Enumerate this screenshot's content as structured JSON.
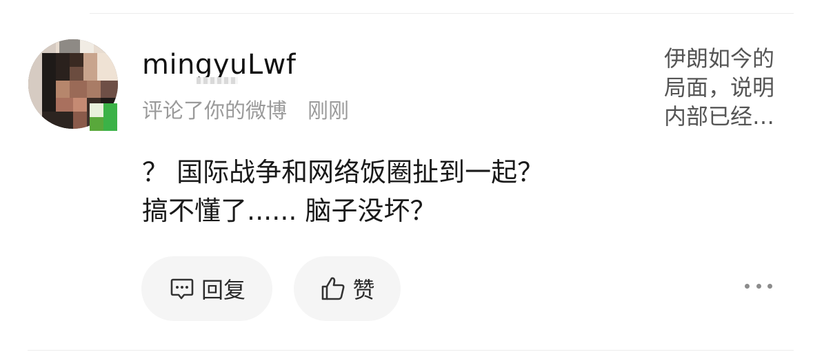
{
  "comment": {
    "username": "mingyuLwf",
    "action": "评论了你的微博",
    "time": "刚刚",
    "quoted_post": "伊朗如今的\n局面，说明\n内部已经…",
    "content_lines": [
      "？ 国际战争和网络饭圈扯到一起？",
      "搞不懂了...... 脑子没坏？"
    ]
  },
  "actions": {
    "reply_label": "回复",
    "like_label": "赞",
    "reply_icon": "comment-bubble-icon",
    "like_icon": "thumbs-up-icon",
    "more_icon": "more-dots-icon"
  }
}
